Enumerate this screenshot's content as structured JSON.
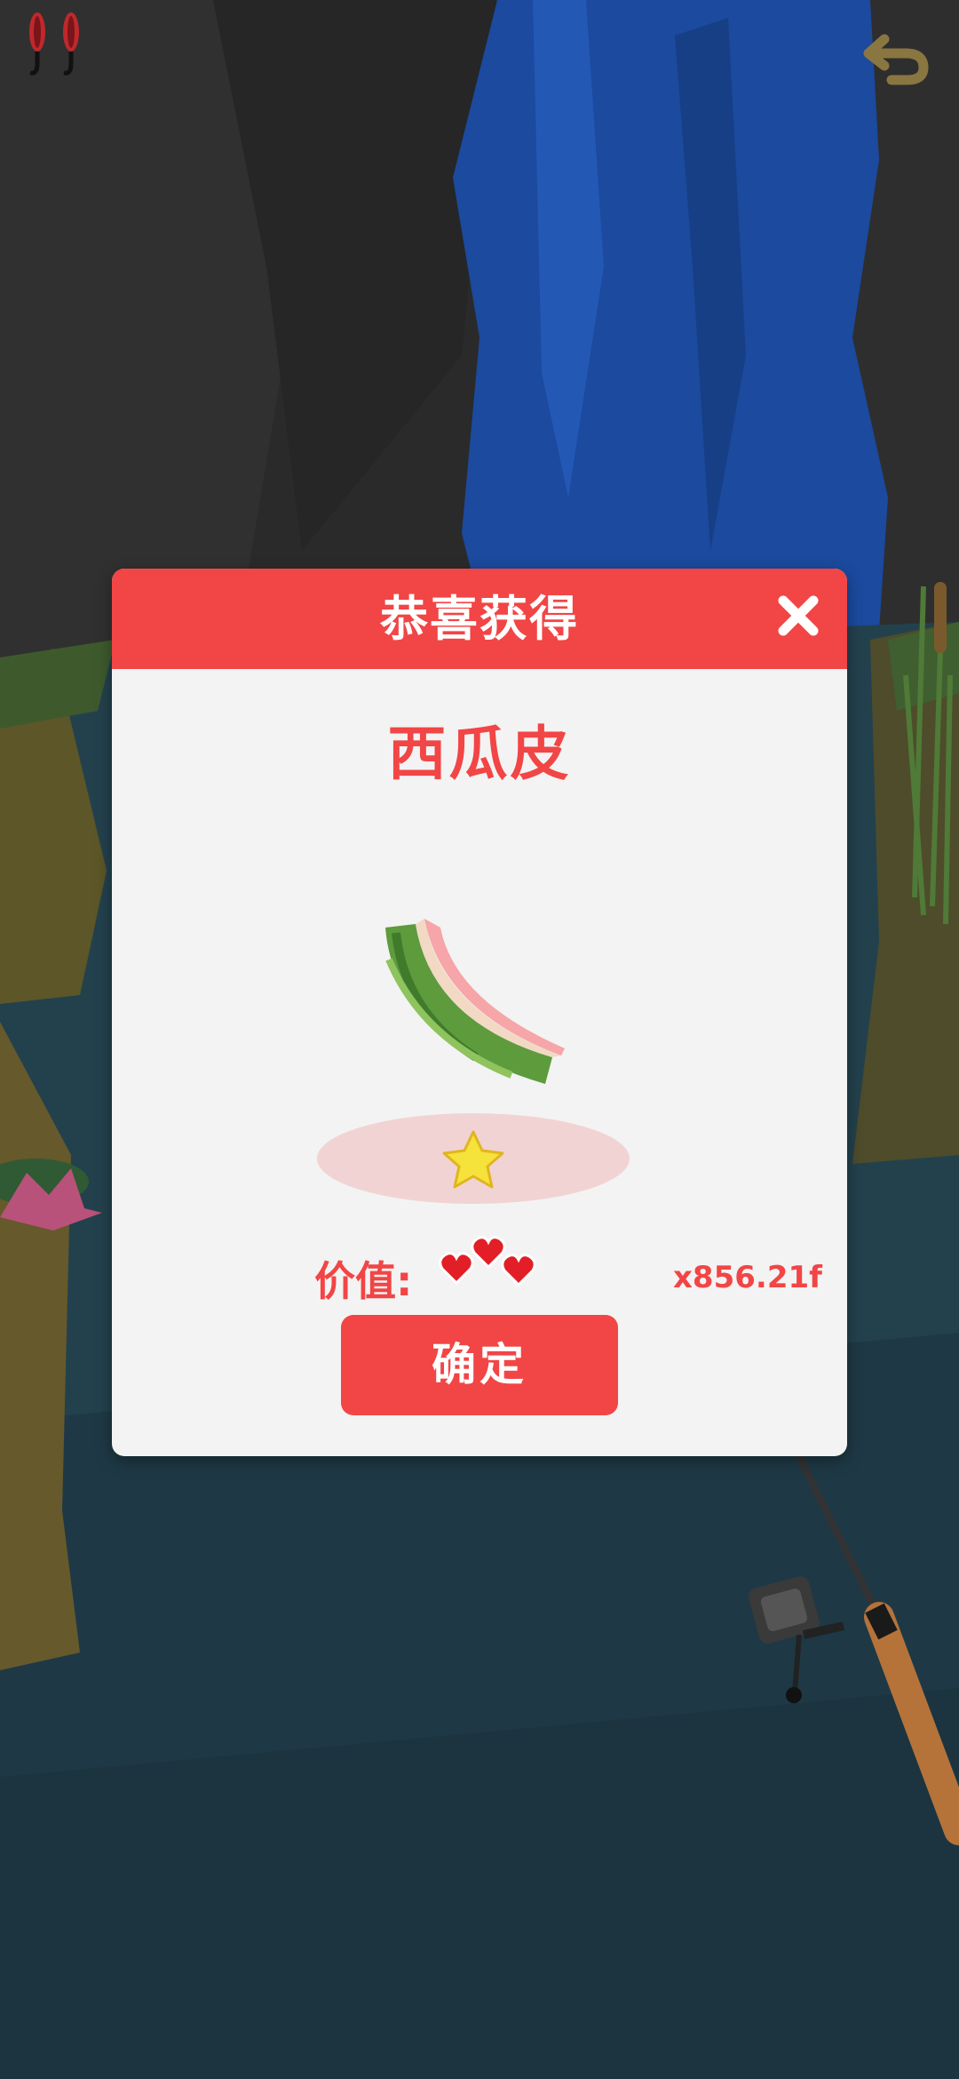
{
  "hud": {
    "bait_icon": "bait-lures-icon",
    "back_icon": "undo-arrow-icon"
  },
  "dialog": {
    "title": "恭喜获得",
    "close_icon": "close-icon",
    "item_name": "西瓜皮",
    "item_icon": "watermelon-rind-icon",
    "rarity_stars": 1,
    "value_label": "价值:",
    "value_icon": "hearts-icon",
    "value_amount": "x856.21f",
    "confirm_label": "确定"
  },
  "colors": {
    "accent_red": "#f24545",
    "panel_bg": "#f3f3f3",
    "star_yellow": "#f5e23a",
    "water": "#1f3b47",
    "waterfall": "#1b4a9e"
  }
}
